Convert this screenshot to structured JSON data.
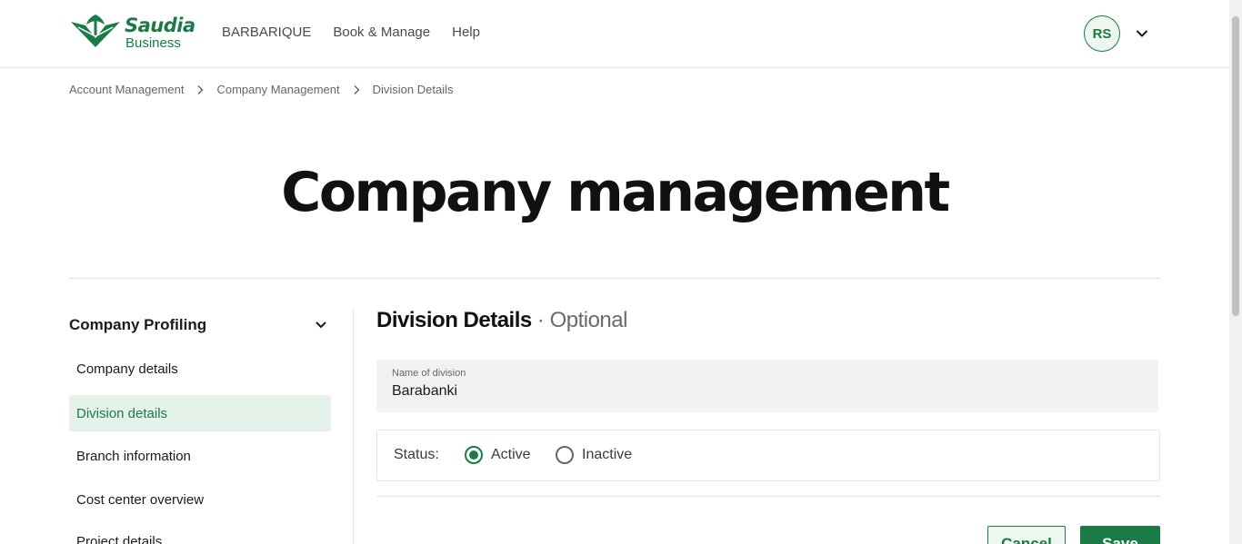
{
  "header": {
    "brand": "Saudia",
    "brand_sub": "Business",
    "nav": [
      "BARBARIQUE",
      "Book & Manage",
      "Help"
    ],
    "avatar_initials": "RS",
    "icons": {
      "avatar_menu": "chevron-down-icon",
      "logo": "palm-swords-logo"
    }
  },
  "breadcrumb": [
    "Account Management",
    "Company Management",
    "Division Details"
  ],
  "page_title": "Company management",
  "sidebar": {
    "heading": "Company Profiling",
    "items": [
      {
        "label": "Company details",
        "active": false
      },
      {
        "label": "Division details",
        "active": true
      },
      {
        "label": "Branch information",
        "active": false
      },
      {
        "label": "Cost center overview",
        "active": false
      },
      {
        "label": "Project details",
        "active": false
      }
    ]
  },
  "main": {
    "title": "Division Details",
    "title_suffix": "Optional",
    "division_name_label": "Name of division",
    "division_name_value": "Barabanki",
    "status_label": "Status:",
    "status_options": [
      "Active",
      "Inactive"
    ],
    "status_selected": "Active",
    "cancel_label": "Cancel",
    "save_label": "Save"
  },
  "colors": {
    "brand_green": "#1b7a45",
    "active_bg": "#e5f2ea"
  }
}
